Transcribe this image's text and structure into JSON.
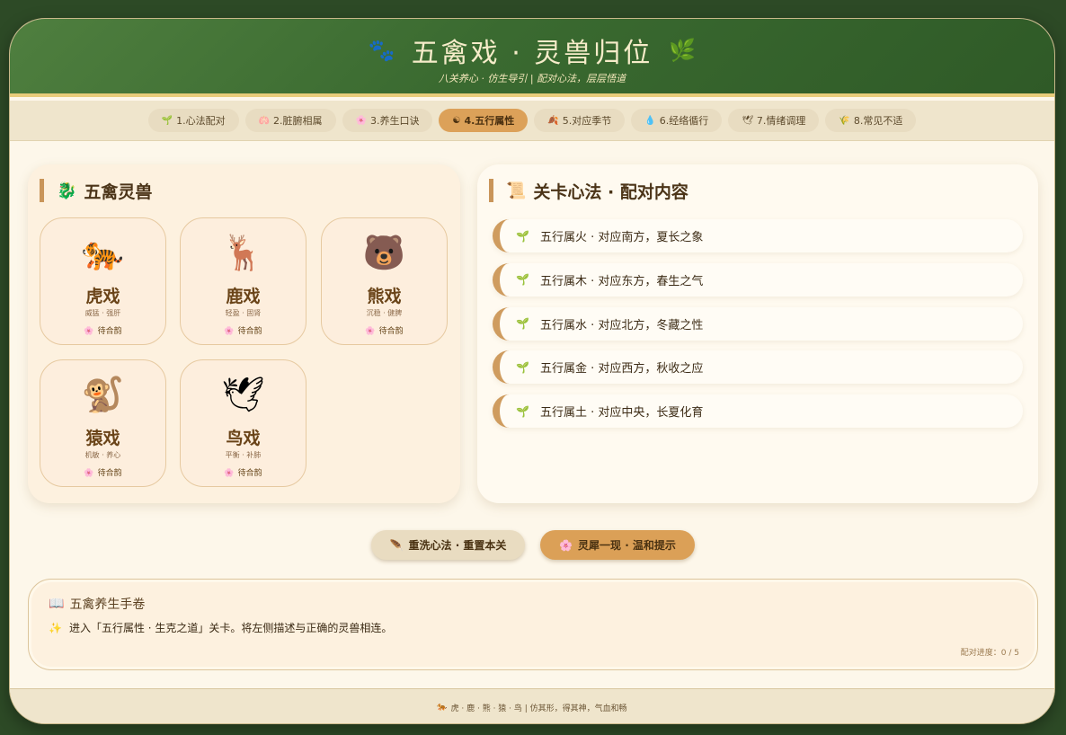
{
  "header": {
    "title": "五禽戏 · 灵兽归位",
    "icon_left": "🐾",
    "icon_right": "🌿",
    "subtitle": "八关养心 · 仿生导引 | 配对心法，层层悟道"
  },
  "tabs": [
    {
      "icon": "🌱",
      "label": "1.心法配对",
      "active": false
    },
    {
      "icon": "🫁",
      "label": "2.脏腑相属",
      "active": false
    },
    {
      "icon": "🌸",
      "label": "3.养生口诀",
      "active": false
    },
    {
      "icon": "☯",
      "label": "4.五行属性",
      "active": true
    },
    {
      "icon": "🍂",
      "label": "5.对应季节",
      "active": false
    },
    {
      "icon": "💧",
      "label": "6.经络循行",
      "active": false
    },
    {
      "icon": "🕊",
      "label": "7.情绪调理",
      "active": false
    },
    {
      "icon": "🌾",
      "label": "8.常见不适",
      "active": false
    }
  ],
  "left_panel": {
    "icon": "🐉",
    "title": "五禽灵兽",
    "beasts": [
      {
        "icon": "🐅",
        "name": "虎戏",
        "desc": "威猛 · 强肝",
        "status": "待合韵",
        "status_icon": "🌸"
      },
      {
        "icon": "🦌",
        "name": "鹿戏",
        "desc": "轻盈 · 固肾",
        "status": "待合韵",
        "status_icon": "🌸"
      },
      {
        "icon": "🐻",
        "name": "熊戏",
        "desc": "沉稳 · 健脾",
        "status": "待合韵",
        "status_icon": "🌸"
      },
      {
        "icon": "🐒",
        "name": "猿戏",
        "desc": "机敏 · 养心",
        "status": "待合韵",
        "status_icon": "🌸"
      },
      {
        "icon": "🕊",
        "name": "鸟戏",
        "desc": "平衡 · 补肺",
        "status": "待合韵",
        "status_icon": "🌸"
      }
    ]
  },
  "right_panel": {
    "icon": "📜",
    "title": "关卡心法 · 配对内容",
    "item_icon": "🌱",
    "items": [
      "五行属火 · 对应南方，夏长之象",
      "五行属木 · 对应东方，春生之气",
      "五行属水 · 对应北方，冬藏之性",
      "五行属金 · 对应西方，秋收之应",
      "五行属土 · 对应中央，长夏化育"
    ]
  },
  "buttons": {
    "reset_icon": "🪶",
    "reset_label": "重洗心法 · 重置本关",
    "hint_icon": "🌸",
    "hint_label": "灵犀一现 · 温和提示"
  },
  "scroll": {
    "icon": "📖",
    "title": "五禽养生手卷",
    "text_icon": "✨",
    "text": "进入「五行属性 · 生克之道」关卡。将左侧描述与正确的灵兽相连。",
    "progress": "配对进度：0 / 5"
  },
  "footer": {
    "icon": "🐅",
    "text": "虎 · 鹿 · 熊 · 猿 · 鸟 | 仿其形，得其神，气血和畅"
  }
}
